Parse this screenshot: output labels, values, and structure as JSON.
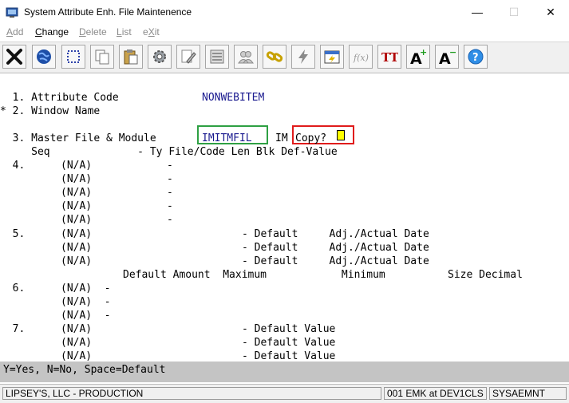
{
  "window": {
    "title": "System Attribute Enh. File Maintenence",
    "minimize": "—",
    "maximize": "☐",
    "close": "✕"
  },
  "menu": [
    {
      "pre": "",
      "key": "A",
      "post": "dd",
      "enabled": false
    },
    {
      "pre": "",
      "key": "C",
      "post": "hange",
      "enabled": true
    },
    {
      "pre": "",
      "key": "D",
      "post": "elete",
      "enabled": false
    },
    {
      "pre": "",
      "key": "L",
      "post": "ist",
      "enabled": false
    },
    {
      "pre": "e",
      "key": "X",
      "post": "it",
      "enabled": false
    }
  ],
  "toolbar_icons": [
    "close-x-icon",
    "globe-icon",
    "select-box-icon",
    "copy-icon",
    "paste-icon",
    "settings-gear-icon",
    "edit-icon",
    "list-icon",
    "users-icon",
    "chain-link-icon",
    "lightning-icon",
    "calendar-icon",
    "function-icon",
    "text-style-icon",
    "font-increase-icon",
    "font-decrease-icon",
    "help-icon"
  ],
  "toolbar_text": {
    "font_style": "TT",
    "font_letter": "A",
    "plus": "+",
    "minus": "−",
    "help": "?",
    "fx": "f(x)"
  },
  "colors": {
    "field_blue": "#1a1a8f",
    "highlight_green": "#2ea043",
    "highlight_red": "#e01b1b",
    "cursor_yellow": "#ffff00"
  },
  "form": {
    "f1_label": "  1. Attribute Code",
    "f1_value": "NONWEBITEM",
    "f2_label": "* 2. Window Name",
    "f3_label": "  3. Master File & Module",
    "f3_value": "IMITMFIL",
    "f3_module": "IM",
    "f3_copy": "Copy?",
    "hdr4": "     Seq              - Ty File/Code Len Blk Def-Value",
    "s4_num": "  4.",
    "na_dash": "(N/A)            -",
    "s5_num": "  5.",
    "na_default_date": "(N/A)                        - Default     Adj./Actual Date",
    "hdr6": "Default Amount  Maximum            Minimum          Size Decimal",
    "s6_num": "  6.",
    "na_short": "(N/A)  -",
    "s7_num": "  7.",
    "na_default_value": "(N/A)                        - Default Value"
  },
  "help_line": "Y=Yes, N=No, Space=Default",
  "status": {
    "company": "LIPSEY'S, LLC - PRODUCTION",
    "session": "001 EMK at DEV1CLS",
    "program": "SYSAEMNT"
  }
}
